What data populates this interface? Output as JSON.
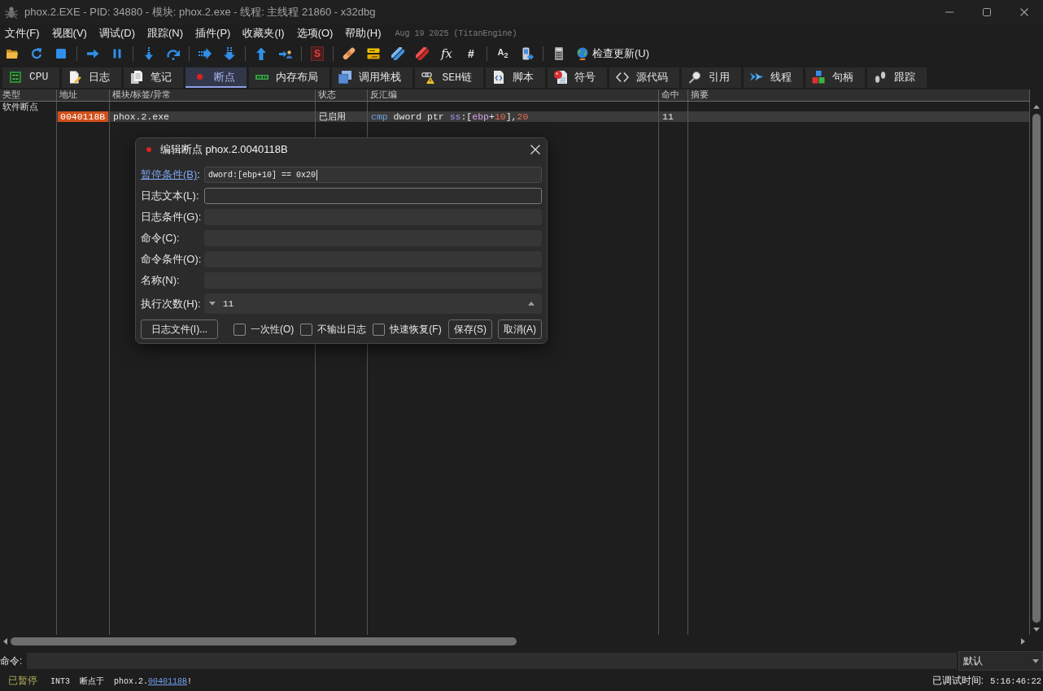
{
  "window": {
    "title": "phox.2.EXE - PID: 34880 - 模块: phox.2.exe - 线程: 主线程 21860 - x32dbg"
  },
  "menu": {
    "items": [
      "文件(F)",
      "视图(V)",
      "调试(D)",
      "跟踪(N)",
      "插件(P)",
      "收藏夹(I)",
      "选项(O)",
      "帮助(H)"
    ],
    "build_info": "Aug 19 2025 (TitanEngine)"
  },
  "toolbar": {
    "glyphs": [
      "S",
      "fx",
      "#",
      "A$_{2}$"
    ],
    "update_label": "检查更新(U)"
  },
  "tabs": [
    {
      "label": "CPU",
      "selected": false
    },
    {
      "label": "日志",
      "selected": false
    },
    {
      "label": "笔记",
      "selected": false
    },
    {
      "label": "断点",
      "selected": true
    },
    {
      "label": "内存布局",
      "selected": false
    },
    {
      "label": "调用堆栈",
      "selected": false
    },
    {
      "label": "SEH链",
      "selected": false
    },
    {
      "label": "脚本",
      "selected": false
    },
    {
      "label": "符号",
      "selected": false
    },
    {
      "label": "源代码",
      "selected": false
    },
    {
      "label": "引用",
      "selected": false
    },
    {
      "label": "线程",
      "selected": false
    },
    {
      "label": "句柄",
      "selected": false
    },
    {
      "label": "跟踪",
      "selected": false
    }
  ],
  "breakpoints": {
    "columns": [
      "类型",
      "地址",
      "模块/标签/异常",
      "状态",
      "反汇编",
      "命中",
      "摘要"
    ],
    "groups": [
      {
        "label": "软件断点",
        "rows": [
          {
            "address": "0040118B",
            "enabled": true,
            "module": "phox.2.exe",
            "status": "已启用",
            "disassembly": [
              {
                "text": "cmp",
                "kind": "mnemonic"
              },
              {
                "text": " dword ptr ",
                "kind": "plain"
              },
              {
                "text": "ss",
                "kind": "segment"
              },
              {
                "text": ":[",
                "kind": "plain"
              },
              {
                "text": "ebp",
                "kind": "register"
              },
              {
                "text": "+",
                "kind": "plain"
              },
              {
                "text": "10",
                "kind": "number"
              },
              {
                "text": "],",
                "kind": "plain"
              },
              {
                "text": "20",
                "kind": "number"
              }
            ],
            "hits": "11",
            "selected": true
          }
        ]
      }
    ]
  },
  "command_bar": {
    "label": "命令:",
    "mode": "默认"
  },
  "status_bar": {
    "state": "已暂停",
    "message_prefix": "INT3  断点于  phox.2.",
    "message_link": "0040118B",
    "message_suffix": "!",
    "elapsed_label": "已调试时间:",
    "elapsed": "5:16:46:22"
  },
  "dialog": {
    "title": "编辑断点 phox.2.0040118B",
    "fields": [
      {
        "kind": "text",
        "label": "暂停条件(B)",
        "label_link": true,
        "label_suffix": ":",
        "value": "dword:[ebp+10] == 0x20",
        "focused": true,
        "hovered": false
      },
      {
        "kind": "text",
        "label": "日志文本(L):",
        "label_link": false,
        "focused": false,
        "hovered": true
      },
      {
        "kind": "text",
        "label": "日志条件(G):",
        "label_link": false,
        "focused": false,
        "hovered": false
      },
      {
        "kind": "text",
        "label": "命令(C):",
        "label_link": false,
        "focused": false,
        "hovered": false
      },
      {
        "kind": "text",
        "label": "命令条件(O):",
        "label_link": false,
        "focused": false,
        "hovered": false
      },
      {
        "kind": "text",
        "label": "名称(N):",
        "label_link": false,
        "focused": false,
        "hovered": false
      },
      {
        "kind": "spin",
        "label": "执行次数(H):",
        "label_link": false,
        "value": "11",
        "focused": false,
        "hovered": false
      }
    ],
    "log_file_button": "日志文件(I)...",
    "options": [
      {
        "label": "一次性(O)",
        "checked": false
      },
      {
        "label": "不输出日志",
        "checked": false
      },
      {
        "label": "快速恢复(F)",
        "checked": false
      }
    ],
    "buttons": [
      "保存(S)",
      "取消(A)"
    ]
  }
}
